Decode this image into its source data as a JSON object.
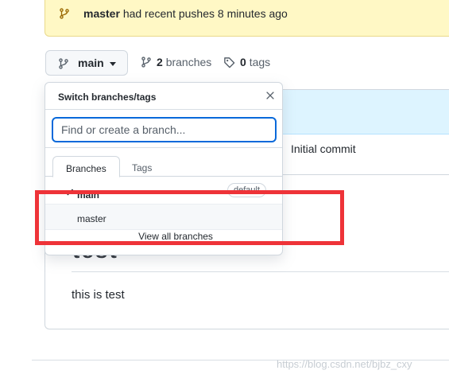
{
  "flash": {
    "branch": "master",
    "message": "had recent pushes 8 minutes ago"
  },
  "branch_button": {
    "label": "main"
  },
  "branches_link": {
    "count": "2",
    "label": "branches"
  },
  "tags_link": {
    "count": "0",
    "label": "tags"
  },
  "panel": {
    "commit_message": "Initial commit",
    "readme_heading": "test",
    "readme_body": "this is test"
  },
  "dropdown": {
    "title": "Switch branches/tags",
    "search": {
      "placeholder": "Find or create a branch...",
      "value": ""
    },
    "tabs": [
      {
        "label": "Branches",
        "active": true
      },
      {
        "label": "Tags",
        "active": false
      }
    ],
    "items": [
      {
        "label": "main",
        "selected": true,
        "badge": "default"
      },
      {
        "label": "master",
        "selected": false
      }
    ],
    "view_all": "View all branches"
  },
  "watermark": "https://blog.csdn.net/bjbz_cxy",
  "colors": {
    "accent": "#0969da",
    "flash_bg": "#fff8c5",
    "annotation": "#ee3338"
  },
  "icons": {
    "flash": "git-branch-icon",
    "branch_button": "git-branch-icon",
    "branches": "git-branch-icon",
    "tags": "tag-icon",
    "close": "close-icon",
    "check": "check-icon"
  }
}
